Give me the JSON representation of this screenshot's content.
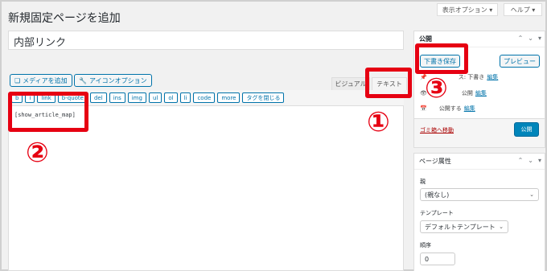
{
  "header": {
    "page_title": "新規固定ページを追加",
    "screen_options": "表示オプション ▾",
    "help": "ヘルプ ▾"
  },
  "title_input": {
    "value": "内部リンク"
  },
  "media": {
    "add_media": "メディアを追加",
    "icon_options": "アイコンオプション"
  },
  "editor_tabs": {
    "visual": "ビジュアル",
    "text": "テキスト"
  },
  "quicktags": [
    "b",
    "i",
    "link",
    "b-quote",
    "del",
    "ins",
    "img",
    "ul",
    "ol",
    "li",
    "code",
    "more",
    "タグを閉じる"
  ],
  "editor": {
    "content": "[show_article_map]"
  },
  "publish": {
    "title": "公開",
    "save_draft": "下書き保存",
    "preview": "プレビュー",
    "status_label": "ス: 下書き",
    "status_edit": "編集",
    "visibility_label": "公開",
    "visibility_edit": "編集",
    "schedule_label": "公開する",
    "schedule_edit": "編集",
    "trash": "ゴミ箱へ移動",
    "publish_button": "公開"
  },
  "page_attributes": {
    "title": "ページ属性",
    "parent_label": "親",
    "parent_value": "(親なし)",
    "template_label": "テンプレート",
    "template_value": "デフォルトテンプレート",
    "order_label": "順序",
    "order_value": "0"
  },
  "annotations": {
    "one": "①",
    "two": "②",
    "three": "③"
  },
  "colors": {
    "accent": "#0073aa",
    "annotation_red": "#e60012",
    "primary_button": "#0085ba"
  }
}
